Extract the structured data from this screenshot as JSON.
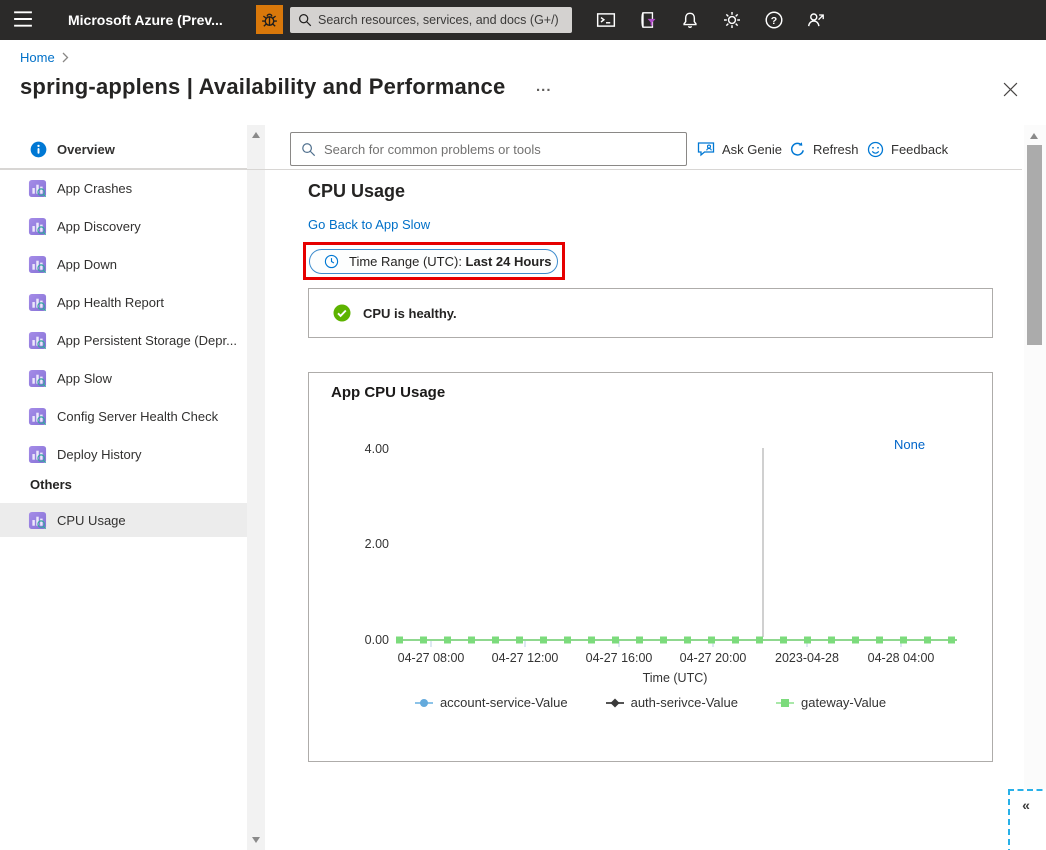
{
  "colors": {
    "accent_blue": "#0078d4",
    "link_blue": "#0070c8",
    "topbar_bg": "#2b2a29",
    "bug_orange": "#d9780a",
    "healthy_green": "#5db300",
    "annotation_red": "#e60000",
    "selected_item_bg": "#ececec",
    "series_account_blue": "#64aadc",
    "series_auth_black": "#3a3a3a",
    "series_gateway_green": "#7cdb7c"
  },
  "header": {
    "title": "Microsoft Azure (Prev...",
    "search_placeholder": "Search resources, services, and docs (G+/)",
    "icons": [
      "hamburger",
      "bug",
      "cloud-shell",
      "directory-filter",
      "notifications",
      "settings",
      "help",
      "feedback-person"
    ]
  },
  "breadcrumb": {
    "home": "Home"
  },
  "page": {
    "title": "spring-applens | Availability and Performance",
    "more": "...",
    "close_icon": "x"
  },
  "sidebar": {
    "overview_label": "Overview",
    "items": [
      "App Crashes",
      "App Discovery",
      "App Down",
      "App Health Report",
      "App Persistent Storage (Depr...",
      "App Slow",
      "Config Server Health Check",
      "Deploy History"
    ],
    "others_label": "Others",
    "cpu_usage_label": "CPU Usage"
  },
  "main": {
    "toolbar": {
      "search_placeholder": "Search for common problems or tools",
      "ask_genie": "Ask Genie",
      "refresh": "Refresh",
      "feedback": "Feedback"
    },
    "heading": "CPU Usage",
    "back_link": "Go Back to App Slow",
    "time_range": {
      "prefix": "Time Range (UTC): ",
      "value": "Last 24 Hours"
    },
    "status_message": "CPU is healthy.",
    "chart_card": {
      "title": "App CPU Usage",
      "none_label": "None"
    },
    "collapse_button": "«"
  },
  "chart_data": {
    "type": "line",
    "title": "App CPU Usage",
    "xlabel": "Time (UTC)",
    "ylabel": "",
    "ylim": [
      0,
      4
    ],
    "grid": false,
    "legend_position": "bottom",
    "yticks": [
      "4.00",
      "2.00",
      "0.00"
    ],
    "xticks": [
      "04-27 08:00",
      "04-27 12:00",
      "04-27 16:00",
      "04-27 20:00",
      "2023-04-28",
      "04-28 04:00"
    ],
    "x": [
      "04-27 06:00",
      "04-27 07:00",
      "04-27 08:00",
      "04-27 09:00",
      "04-27 10:00",
      "04-27 11:00",
      "04-27 12:00",
      "04-27 13:00",
      "04-27 14:00",
      "04-27 15:00",
      "04-27 16:00",
      "04-27 17:00",
      "04-27 18:00",
      "04-27 19:00",
      "04-27 20:00",
      "04-27 21:00",
      "04-27 22:00",
      "04-27 23:00",
      "04-28 00:00",
      "04-28 01:00",
      "04-28 02:00",
      "04-28 03:00",
      "04-28 04:00",
      "04-28 05:00"
    ],
    "series": [
      {
        "name": "account-service-Value",
        "marker": "circle",
        "color": "#64aadc",
        "values": [
          0,
          0,
          0,
          0,
          0,
          0,
          0,
          0,
          0,
          0,
          0,
          0,
          0,
          0,
          0,
          0,
          0,
          0,
          0,
          0,
          0,
          0,
          0,
          0
        ]
      },
      {
        "name": "auth-serivce-Value",
        "marker": "diamond",
        "color": "#3a3a3a",
        "values": [
          0,
          0,
          0,
          0,
          0,
          0,
          0,
          0,
          0,
          0,
          0,
          0,
          0,
          0,
          0,
          0,
          0,
          0,
          0,
          0,
          0,
          0,
          0,
          0
        ]
      },
      {
        "name": "gateway-Value",
        "marker": "square",
        "color": "#7cdb7c",
        "values": [
          0,
          0,
          0,
          0,
          0,
          0,
          0,
          0,
          0,
          0,
          0,
          0,
          0,
          0,
          0,
          0,
          0,
          0,
          0,
          0,
          0,
          0,
          0,
          0
        ]
      }
    ],
    "annotations": [
      {
        "type": "vline",
        "x_fraction": 0.66
      }
    ]
  }
}
